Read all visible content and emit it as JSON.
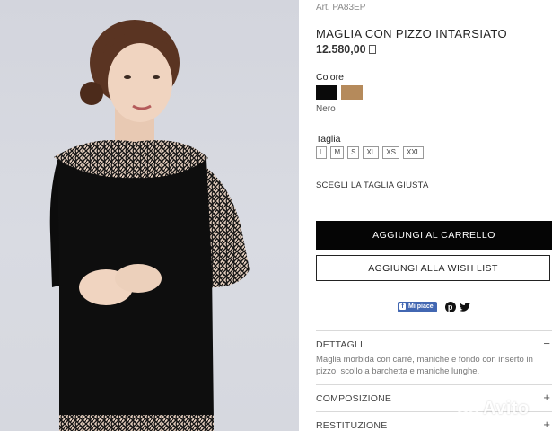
{
  "product": {
    "article": "Art. PA83EP",
    "title": "MAGLIA CON PIZZO INTARSIATO",
    "price": "12.580,00"
  },
  "colors": {
    "label": "Colore",
    "options": [
      {
        "name": "Nero",
        "hex": "#0a0a0a"
      },
      {
        "name": "Cammello",
        "hex": "#b58a5b"
      }
    ],
    "selected": "Nero"
  },
  "sizes": {
    "label": "Taglia",
    "options": [
      "L",
      "M",
      "S",
      "XL",
      "XS",
      "XXL"
    ],
    "fit_link": "SCEGLI LA TAGLIA GIUSTA"
  },
  "actions": {
    "add_to_cart": "AGGIUNGI AL CARRELLO",
    "add_to_wishlist": "AGGIUNGI ALLA WISH LIST"
  },
  "social": {
    "fb_like": "Mi piace"
  },
  "accordion": {
    "details_title": "DETTAGLI",
    "details_toggle": "−",
    "details_body": "Maglia morbida con carrè, maniche e fondo con inserto in pizzo, scollo a barchetta e maniche lunghe.",
    "composition_title": "COMPOSIZIONE",
    "composition_toggle": "+",
    "returns_title": "RESTITUZIONE",
    "returns_toggle": "+"
  },
  "watermark": {
    "text": "Avito"
  },
  "theme": {
    "primary": "#050505",
    "photo_bg": "#d6d8df",
    "facebook": "#4267b2"
  }
}
